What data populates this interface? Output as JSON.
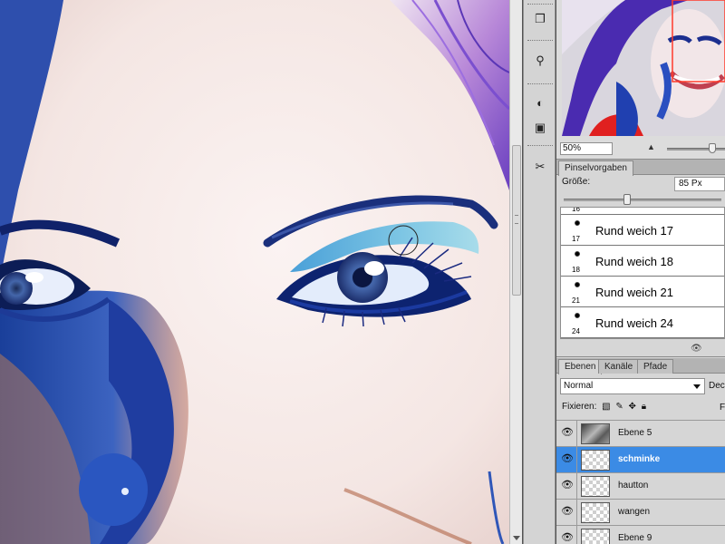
{
  "navigator": {
    "zoom_value": "50%"
  },
  "tools": [
    {
      "icon": "history-brush-icon",
      "glyph": "❐"
    },
    {
      "icon": "clone-stamp-icon",
      "glyph": "⚲"
    },
    {
      "icon": "rotate-icon",
      "glyph": "↺"
    },
    {
      "icon": "adjustment-icon",
      "glyph": "◐"
    },
    {
      "icon": "mask-icon",
      "glyph": "▣"
    },
    {
      "icon": "brush-tools-icon",
      "glyph": "✂"
    }
  ],
  "brush_presets": {
    "tab_label": "Pinselvorgaben",
    "size_label": "Größe:",
    "size_value": "85 Px",
    "partial_top_number": "16",
    "items": [
      {
        "number": "17",
        "name": "Rund weich 17"
      },
      {
        "number": "18",
        "name": "Rund weich 18"
      },
      {
        "number": "21",
        "name": "Rund weich 21"
      },
      {
        "number": "24",
        "name": "Rund weich 24"
      }
    ]
  },
  "layers_panel": {
    "tabs": [
      "Ebenen",
      "Kanäle",
      "Pfade"
    ],
    "blend_mode": "Normal",
    "opacity_label": "Deck",
    "lock_label": "Fixieren:",
    "fill_label": "F",
    "layers": [
      {
        "name": "Ebene 5",
        "thumb": "photo",
        "selected": false
      },
      {
        "name": "schminke",
        "thumb": "transparent",
        "selected": true
      },
      {
        "name": "hautton",
        "thumb": "transparent",
        "selected": false
      },
      {
        "name": "wangen",
        "thumb": "transparent",
        "selected": false
      },
      {
        "name": "Ebene 9",
        "thumb": "transparent",
        "selected": false
      }
    ]
  },
  "colors": {
    "selection_blue": "#3b8be5",
    "panel_gray": "#d6d6d6",
    "navigator_view_box": "#ff3a2a"
  }
}
